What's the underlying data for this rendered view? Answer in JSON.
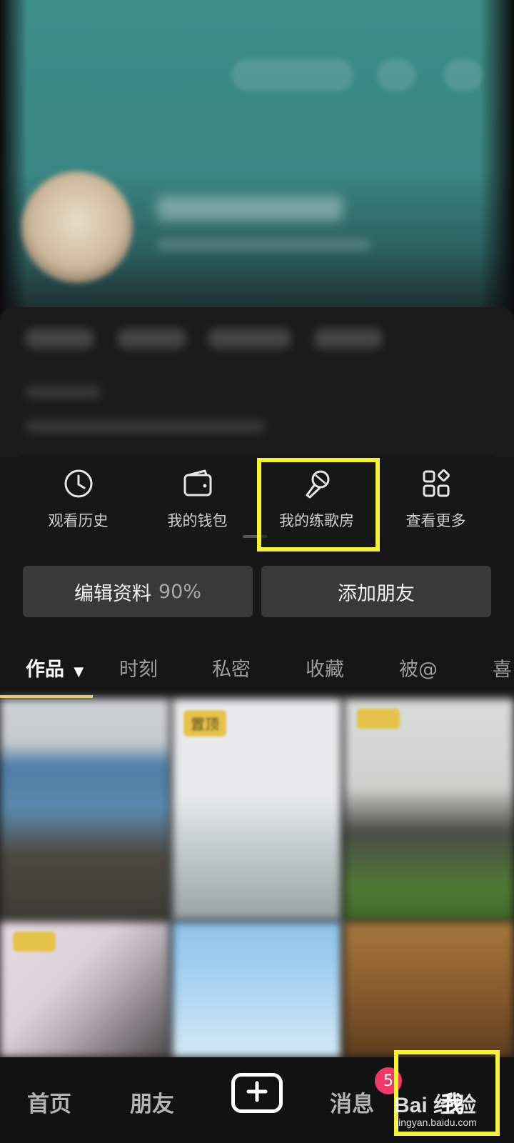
{
  "shortcuts": [
    {
      "label": "观看历史",
      "icon": "clock-icon"
    },
    {
      "label": "我的钱包",
      "icon": "wallet-icon"
    },
    {
      "label": "我的练歌房",
      "icon": "microphone-icon"
    },
    {
      "label": "查看更多",
      "icon": "grid-more-icon"
    }
  ],
  "actions": {
    "edit_profile_label": "编辑资料",
    "edit_profile_progress": "90%",
    "add_friends_label": "添加朋友"
  },
  "tabs": [
    {
      "label": "作品",
      "active": true
    },
    {
      "label": "时刻"
    },
    {
      "label": "私密"
    },
    {
      "label": "收藏"
    },
    {
      "label": "被@"
    },
    {
      "label": "喜"
    }
  ],
  "grid": {
    "pinned_badge": "置顶"
  },
  "bottom_nav": {
    "home": "首页",
    "friends": "朋友",
    "create_icon": "plus-icon",
    "messages": "消息",
    "messages_badge": "5",
    "me": "我"
  },
  "watermark": {
    "text": "Bai 经验",
    "sub": "jingyan.baidu.com"
  },
  "colors": {
    "highlight": "#f5f03a",
    "tab_underline": "#f2c64a",
    "badge": "#f0386b"
  }
}
